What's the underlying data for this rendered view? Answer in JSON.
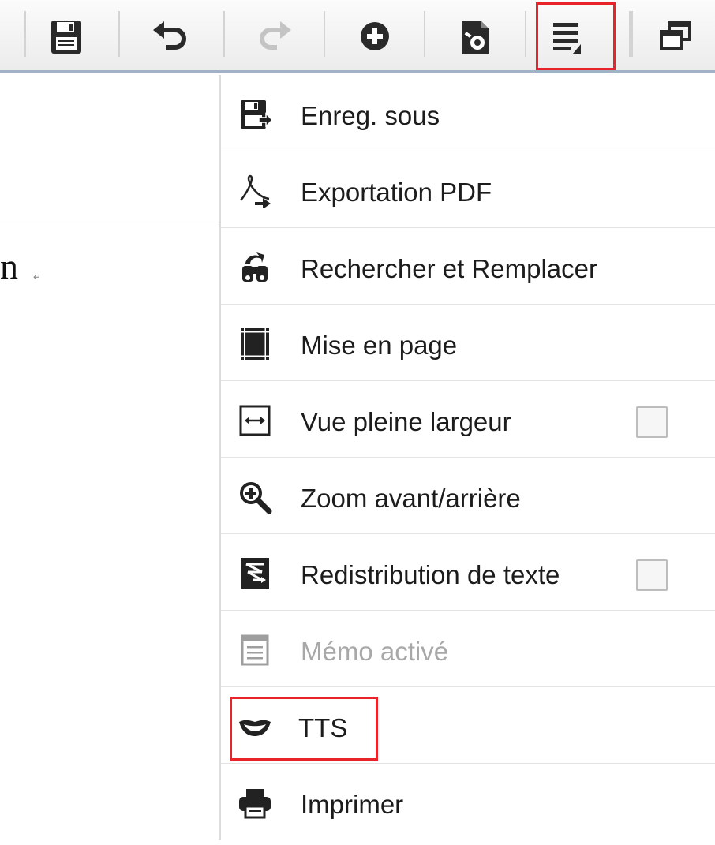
{
  "toolbar": {
    "buttons": [
      {
        "name": "save",
        "icon": "floppy-disk-icon"
      },
      {
        "name": "undo",
        "icon": "undo-icon"
      },
      {
        "name": "redo",
        "icon": "redo-icon",
        "disabled": true
      },
      {
        "name": "insert",
        "icon": "plus-circle-icon"
      },
      {
        "name": "tools",
        "icon": "document-tools-icon"
      },
      {
        "name": "menu",
        "icon": "menu-icon",
        "highlighted": true
      },
      {
        "name": "windows",
        "icon": "windows-icon"
      }
    ]
  },
  "document": {
    "visible_text": "n",
    "return_mark": "↵"
  },
  "menu": {
    "items": [
      {
        "label": "Enreg. sous",
        "icon": "save-as-icon"
      },
      {
        "label": "Exportation PDF",
        "icon": "pdf-export-icon"
      },
      {
        "label": "Rechercher et Remplacer",
        "icon": "find-replace-icon"
      },
      {
        "label": "Mise en page",
        "icon": "page-layout-icon"
      },
      {
        "label": "Vue pleine largeur",
        "icon": "full-width-icon",
        "checkbox": false
      },
      {
        "label": "Zoom avant/arrière",
        "icon": "zoom-icon"
      },
      {
        "label": "Redistribution de texte",
        "icon": "text-reflow-icon",
        "checkbox": false
      },
      {
        "label": "Mémo activé",
        "icon": "memo-icon",
        "disabled": true
      },
      {
        "label": "TTS",
        "icon": "lips-icon",
        "highlighted": true
      },
      {
        "label": "Imprimer",
        "icon": "printer-icon"
      }
    ]
  },
  "colors": {
    "highlight": "#e8242a",
    "icon": "#222222",
    "disabled": "#a8a8a8"
  }
}
